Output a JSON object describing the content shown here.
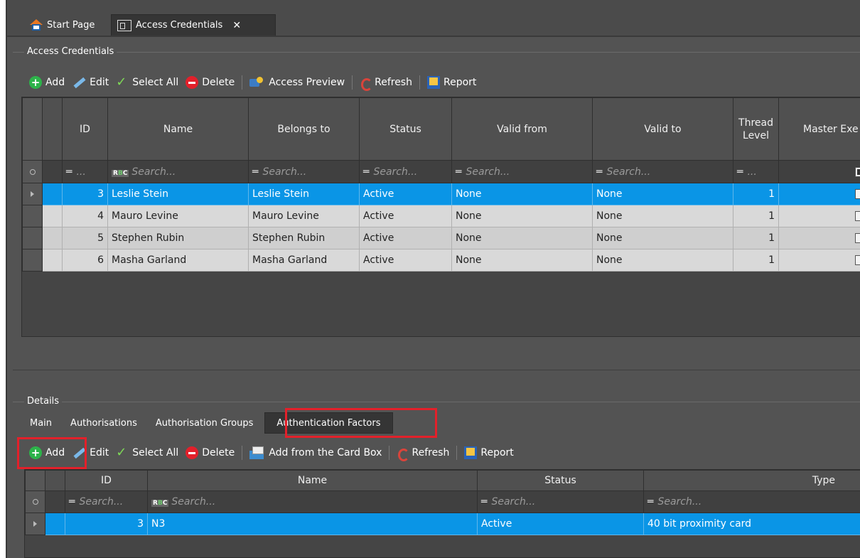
{
  "tabs": [
    {
      "label": "Start Page",
      "icon": "home-icon"
    },
    {
      "label": "Access Credentials",
      "icon": "credential-icon",
      "closable": true
    }
  ],
  "credentials": {
    "group_title": "Access Credentials",
    "toolbar": {
      "add": "Add",
      "edit": "Edit",
      "select_all": "Select All",
      "delete": "Delete",
      "access_preview": "Access Preview",
      "refresh": "Refresh",
      "report": "Report"
    },
    "columns": {
      "id": "ID",
      "name": "Name",
      "belongs_to": "Belongs to",
      "status": "Status",
      "valid_from": "Valid from",
      "valid_to": "Valid to",
      "thread_level": "Thread Level",
      "master_exe": "Master Exe"
    },
    "filter": {
      "id": "...",
      "name": "Search...",
      "belongs_to": "Search...",
      "status": "Search...",
      "valid_from": "Search...",
      "valid_to": "Search...",
      "thread_level": "..."
    },
    "rows": [
      {
        "id": "3",
        "name": "Leslie Stein",
        "belongs_to": "Leslie Stein",
        "status": "Active",
        "valid_from": "None",
        "valid_to": "None",
        "thread_level": "1",
        "selected": true
      },
      {
        "id": "4",
        "name": "Mauro Levine",
        "belongs_to": "Mauro Levine",
        "status": "Active",
        "valid_from": "None",
        "valid_to": "None",
        "thread_level": "1"
      },
      {
        "id": "5",
        "name": "Stephen Rubin",
        "belongs_to": "Stephen Rubin",
        "status": "Active",
        "valid_from": "None",
        "valid_to": "None",
        "thread_level": "1"
      },
      {
        "id": "6",
        "name": "Masha Garland",
        "belongs_to": "Masha Garland",
        "status": "Active",
        "valid_from": "None",
        "valid_to": "None",
        "thread_level": "1"
      }
    ]
  },
  "details": {
    "group_title": "Details",
    "tabs": [
      "Main",
      "Authorisations",
      "Authorisation Groups",
      "Authentication Factors"
    ],
    "active_tab": "Authentication Factors",
    "toolbar": {
      "add": "Add",
      "edit": "Edit",
      "select_all": "Select All",
      "delete": "Delete",
      "add_from_card_box": "Add from the Card Box",
      "refresh": "Refresh",
      "report": "Report"
    },
    "columns": {
      "id": "ID",
      "name": "Name",
      "status": "Status",
      "type": "Type"
    },
    "filter": {
      "id": "Search...",
      "name": "Search...",
      "status": "Search...",
      "type": "Search..."
    },
    "rows": [
      {
        "id": "3",
        "name": "N3",
        "status": "Active",
        "type": "40 bit proximity card",
        "selected": true
      }
    ]
  },
  "colors": {
    "selection": "#0a95e6",
    "highlight": "#e3202a",
    "add_green": "#2db34a",
    "delete_red": "#e2202b"
  }
}
